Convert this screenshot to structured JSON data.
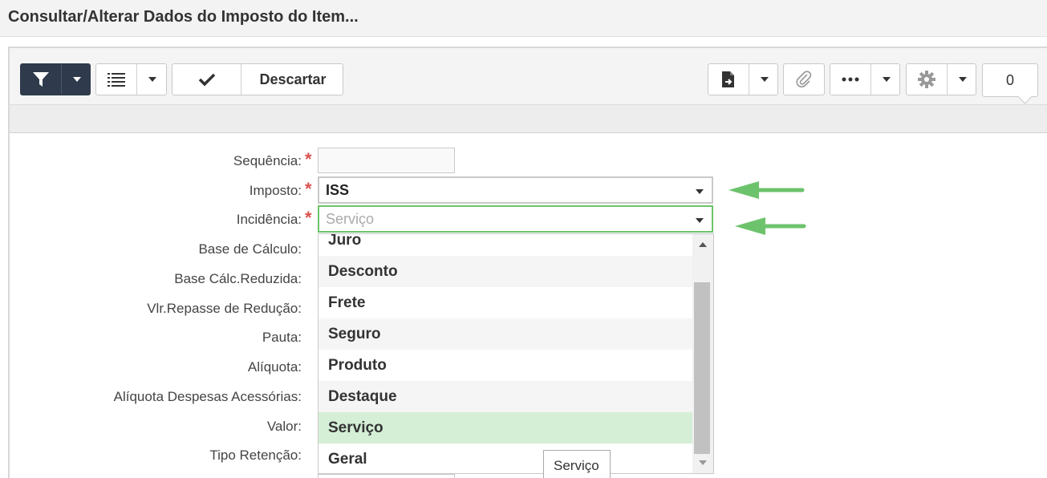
{
  "page": {
    "title": "Consultar/Alterar Dados do Imposto do Item..."
  },
  "toolbar": {
    "descartar_label": "Descartar",
    "counter_value": "0"
  },
  "form": {
    "sequencia_label": "Sequência:",
    "imposto_label": "Imposto:",
    "imposto_value": "ISS",
    "incidencia_label": "Incidência:",
    "incidencia_placeholder": "Serviço",
    "base_calculo_label": "Base de Cálculo:",
    "base_calc_reduzida_label": "Base Cálc.Reduzida:",
    "vlr_repasse_label": "Vlr.Repasse de Redução:",
    "pauta_label": "Pauta:",
    "aliquota_label": "Alíquota:",
    "aliquota_despesas_label": "Alíquota Despesas Acessórias:",
    "valor_label": "Valor:",
    "tipo_retencao_label": "Tipo Retenção:",
    "required_mark": "*"
  },
  "dropdown": {
    "options": [
      "Juro",
      "Desconto",
      "Frete",
      "Seguro",
      "Produto",
      "Destaque",
      "Serviço",
      "Geral"
    ],
    "selected": "Serviço"
  },
  "tooltip": {
    "text": "Serviço"
  },
  "colors": {
    "accent_green": "#6cc36c",
    "filter_button": "#2f3b4c",
    "required_red": "#d9534f",
    "selected_option": "#d5efd7"
  }
}
